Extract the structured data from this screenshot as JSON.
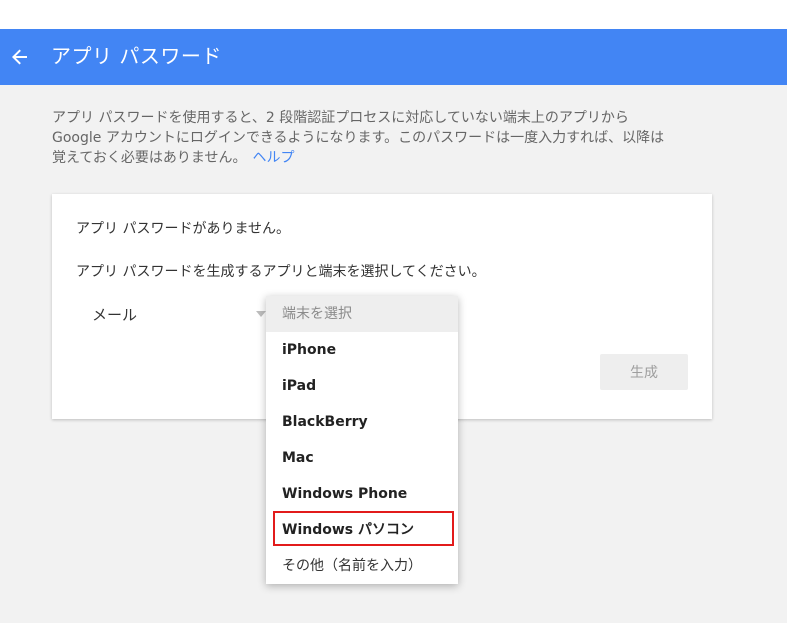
{
  "appbar": {
    "title": "アプリ パスワード",
    "back_icon": "arrow-left-icon",
    "color": "#4285f4"
  },
  "intro": {
    "line1": "アプリ パスワードを使用すると、2 段階認証プロセスに対応していない端末上のアプリから",
    "line2": "Google アカウントにログインできるようになります。このパスワードは一度入力すれば、以降は",
    "line3": "覚えておく必要はありません。",
    "help_link": "ヘルプ"
  },
  "card": {
    "no_passwords": "アプリ パスワードがありません。",
    "instruction": "アプリ パスワードを生成するアプリと端末を選択してください。",
    "app_select_value": "メール",
    "generate_label": "生成"
  },
  "device_dropdown": {
    "placeholder": "端末を選択",
    "options": [
      "iPhone",
      "iPad",
      "BlackBerry",
      "Mac",
      "Windows Phone",
      "Windows パソコン",
      "その他（名前を入力）"
    ],
    "highlighted": "Windows パソコン",
    "highlight_color": "#e21b1b"
  }
}
